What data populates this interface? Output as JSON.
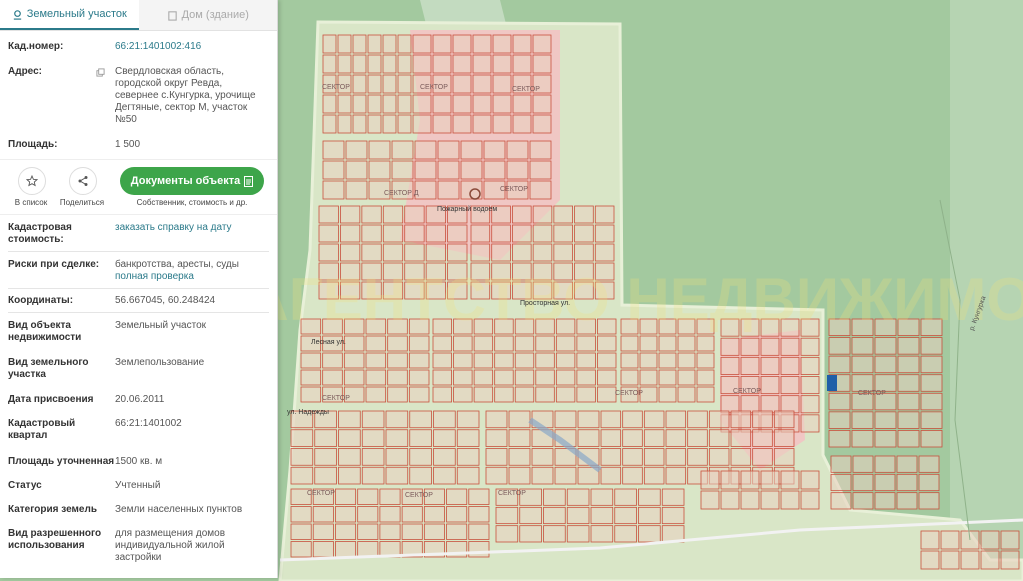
{
  "tabs": [
    {
      "label": "Земельный участок",
      "icon": "map-pin-icon"
    },
    {
      "label": "Дом (здание)",
      "icon": "building-icon"
    }
  ],
  "fields": {
    "cad_number": {
      "label": "Кад.номер:",
      "value": "66:21:1401002:416"
    },
    "address": {
      "label": "Адрес:",
      "lines": [
        "Свердловская область,",
        "городской округ Ревда,",
        "севернее с.Кунгурка, урочище",
        "Дегтяные, сектор М, участок",
        "№50"
      ]
    },
    "area": {
      "label": "Площадь:",
      "value": "1 500"
    }
  },
  "actions": {
    "favorite_label": "В список",
    "share_label": "Поделиться",
    "documents_label": "Документы объекта",
    "documents_sub": "Собственник, стоимость и др."
  },
  "details": {
    "cad_cost": {
      "label_lines": [
        "Кадастровая",
        "стоимость:"
      ],
      "value": "заказать справку на дату"
    },
    "risks": {
      "label": "Риски при сделке:",
      "value": "банкротства, аресты, суды",
      "link": "полная проверка"
    },
    "coords": {
      "label": "Координаты:",
      "value": "56.667045, 60.248424"
    },
    "object_type": {
      "label_lines": [
        "Вид объекта",
        "недвижимости"
      ],
      "value": "Земельный участок"
    },
    "land_type": {
      "label_lines": [
        "Вид земельного",
        "участка"
      ],
      "value": "Землепользование"
    },
    "assign_date": {
      "label": "Дата присвоения",
      "value": "20.06.2011"
    },
    "quarter": {
      "label_lines": [
        "Кадастровый",
        "квартал"
      ],
      "value": "66:21:1401002"
    },
    "area_exact": {
      "label": "Площадь уточненная",
      "value": "1500 кв. м"
    },
    "status": {
      "label": "Статус",
      "value": "Учтенный"
    },
    "category": {
      "label": "Категория земель",
      "value": "Земли населенных пунктов"
    },
    "permitted_use": {
      "label_lines": [
        "Вид разрешенного",
        "использования"
      ],
      "value_lines": [
        "для размещения домов",
        "индивидуальной жилой",
        "застройки"
      ]
    }
  },
  "map": {
    "labels": [
      "СЕКТОР",
      "СЕКТОР",
      "СЕКТОР",
      "СЕКТОР Д",
      "СЕКТОР",
      "Пожарный водоем",
      "Просторная ул.",
      "Лесная ул.",
      "ул. Надежды",
      "СЕКТОР",
      "СЕКТОР",
      "СЕКТОР",
      "СЕКТОР",
      "СЕКТОР",
      "СЕКТОР",
      "СЕКТОР",
      "р. Кунгурка"
    ],
    "watermark": "АГЕНТСТВО НЕДВИЖИМОСТИ",
    "colors": {
      "forest": "#9fc79b",
      "plots_fill": "#e9cfc0",
      "plot_border": "#c9503d",
      "highlight": "#f3c6c6",
      "marker": "#1f5fa8"
    }
  }
}
